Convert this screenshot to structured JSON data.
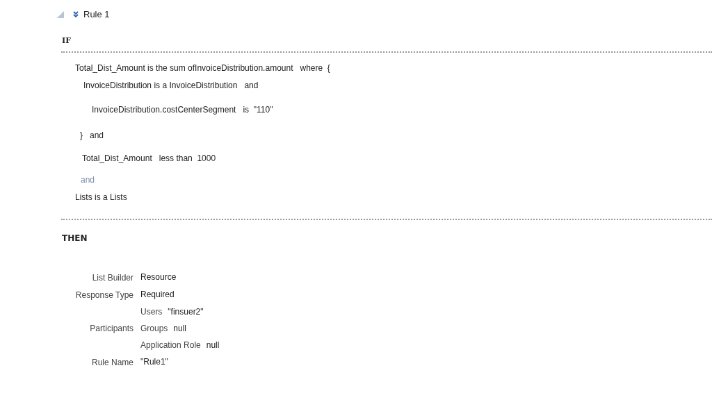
{
  "rule": {
    "title": "Rule 1",
    "expanded": true
  },
  "if_section": {
    "heading": "IF",
    "lines": [
      {
        "kind": "clause",
        "text": "Total_Dist_Amount is the sum ofInvoiceDistribution.amount   where  {"
      },
      {
        "kind": "clause",
        "text": "InvoiceDistribution is a InvoiceDistribution   and"
      },
      {
        "kind": "clause",
        "text": "InvoiceDistribution.costCenterSegment   is  \"110\""
      },
      {
        "kind": "clause",
        "text": "}   and"
      },
      {
        "kind": "clause",
        "text": "Total_Dist_Amount   less than  1000"
      },
      {
        "kind": "connector",
        "text": "and"
      },
      {
        "kind": "clause",
        "text": "Lists is a Lists"
      }
    ]
  },
  "then_section": {
    "heading": "THEN",
    "rows": [
      {
        "label": "List Builder",
        "values": [
          {
            "value": "Resource"
          }
        ]
      },
      {
        "label": "Response Type",
        "values": [
          {
            "value": "Required"
          }
        ]
      },
      {
        "label": "Participants",
        "values": [
          {
            "name": "Users",
            "value": "\"finsuer2\""
          },
          {
            "name": "Groups",
            "value": "null"
          },
          {
            "name": "Application Role",
            "value": "null"
          }
        ]
      },
      {
        "label": "Rule Name",
        "values": [
          {
            "value": "\"Rule1\""
          }
        ]
      }
    ]
  }
}
